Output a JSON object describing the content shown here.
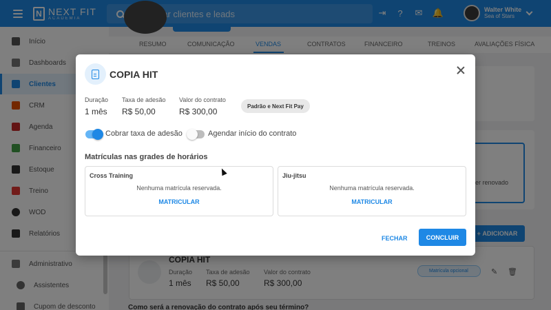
{
  "topbar": {
    "logo_main": "NEXT FIT",
    "logo_sub": "ACADEMIA",
    "search_placeholder": "Pesquisar clientes e leads",
    "user_name": "Walter White",
    "user_org": "Sea of Stars"
  },
  "sidebar": {
    "items": [
      {
        "label": "Início",
        "icon": "home-icon",
        "color": "#555555"
      },
      {
        "label": "Dashboards",
        "icon": "chart-icon",
        "color": "#555555"
      },
      {
        "label": "Clientes",
        "icon": "people-icon",
        "color": "#1e88e5"
      },
      {
        "label": "CRM",
        "icon": "crm-icon",
        "color": "#e65100"
      },
      {
        "label": "Agenda",
        "icon": "calendar-icon",
        "color": "#c62828"
      },
      {
        "label": "Financeiro",
        "icon": "money-icon",
        "color": "#43a047"
      },
      {
        "label": "Estoque",
        "icon": "cart-icon",
        "color": "#333333"
      },
      {
        "label": "Treino",
        "icon": "dumbbell-icon",
        "color": "#e53935"
      },
      {
        "label": "WOD",
        "icon": "kettlebell-icon",
        "color": "#333333"
      },
      {
        "label": "Relatórios",
        "icon": "report-icon",
        "color": "#333333"
      },
      {
        "label": "Administrativo",
        "icon": "admin-icon",
        "color": "#555555"
      },
      {
        "label": "Assistentes",
        "icon": "gear-icon",
        "color": "#555555"
      },
      {
        "label": "Cupom de desconto",
        "icon": "ticket-icon",
        "color": "#555555"
      }
    ]
  },
  "tabs": [
    "RESUMO",
    "COMUNICAÇÃO",
    "VENDAS",
    "CONTRATOS",
    "FINANCEIRO",
    "TREINOS",
    "AVALIAÇÕES FÍSICA"
  ],
  "background": {
    "renew_text": "er renovado",
    "add_button": "ADICIONAR",
    "plan_title": "COPIA HIT",
    "labels": [
      "Duração",
      "Taxa de adesão",
      "Valor do contrato"
    ],
    "values": [
      "1 mês",
      "R$ 50,00",
      "R$ 300,00"
    ],
    "optional_badge": "Matrícula opcional",
    "renew_question": "Como será a renovação do contrato após seu término?"
  },
  "modal": {
    "title": "COPIA HIT",
    "duration_label": "Duração",
    "duration_value": "1 mês",
    "fee_label": "Taxa de adesão",
    "fee_value": "R$ 50,00",
    "contract_label": "Valor do contrato",
    "contract_value": "R$ 300,00",
    "payment_badge": "Padrão e Next Fit Pay",
    "toggle_fee_label": "Cobrar taxa de adesão",
    "toggle_fee_on": true,
    "toggle_schedule_label": "Agendar início do contrato",
    "toggle_schedule_on": false,
    "section_title": "Matrículas nas grades de horários",
    "schedules": [
      {
        "name": "Cross Training",
        "empty": "Nenhuma matrícula reservada.",
        "action": "MATRICULAR"
      },
      {
        "name": "Jiu-jitsu",
        "empty": "Nenhuma matrícula reservada.",
        "action": "MATRICULAR"
      }
    ],
    "close_label": "FECHAR",
    "confirm_label": "CONCLUIR"
  }
}
